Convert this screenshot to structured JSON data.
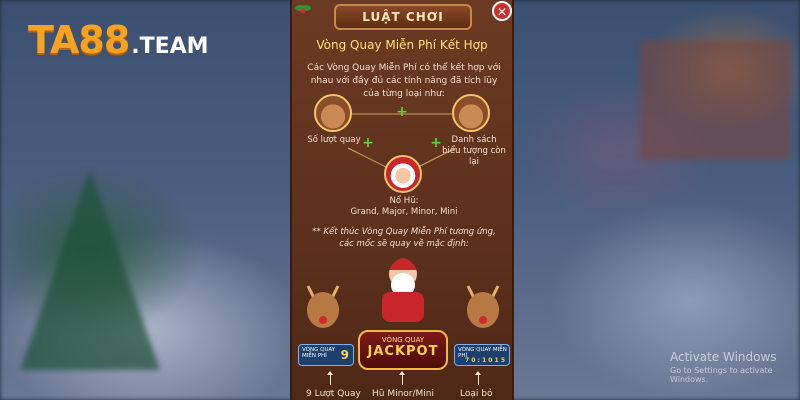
{
  "brand": {
    "logo_main": "TA88",
    "logo_suffix": ".TEAM"
  },
  "dialog": {
    "header": "LUẬT CHƠI",
    "close_label": "✕",
    "title": "Vòng Quay Miễn Phí Kết Hợp",
    "intro": "Các Vòng Quay Miễn Phí có thể kết hợp với nhau với đầy đủ các tính năng đã tích lũy của từng loại như:",
    "nodes": {
      "left_label": "Số lượt quay",
      "right_label": "Danh sách biểu tượng còn lại",
      "bottom_label": "Nổ Hũ:",
      "bottom_sub": "Grand, Major, Minor, Mini"
    },
    "note": "** Kết thúc Vòng Quay Miễn Phí tương ứng, các mốc sẽ quay về mặc định:",
    "jackpot": {
      "small": "VÒNG QUAY",
      "big": "JACKPOT"
    },
    "left_badge": {
      "text": "VÒNG QUAY MIỄN PHÍ",
      "count": "9"
    },
    "right_badge": {
      "text": "VÒNG QUAY MIỄN PHÍ",
      "count": "7 0 : 1 0 1 5"
    },
    "footer": {
      "left": "9 Lượt Quay",
      "center": "Hũ Minor/Mini",
      "right": "Loại bỏ"
    }
  },
  "watermark": {
    "line1": "Activate Windows",
    "line2": "Go to Settings to activate Windows."
  },
  "colors": {
    "accent": "#f5a321",
    "panel": "#5c301c",
    "title": "#ffe27a",
    "plus": "#63d13c"
  }
}
